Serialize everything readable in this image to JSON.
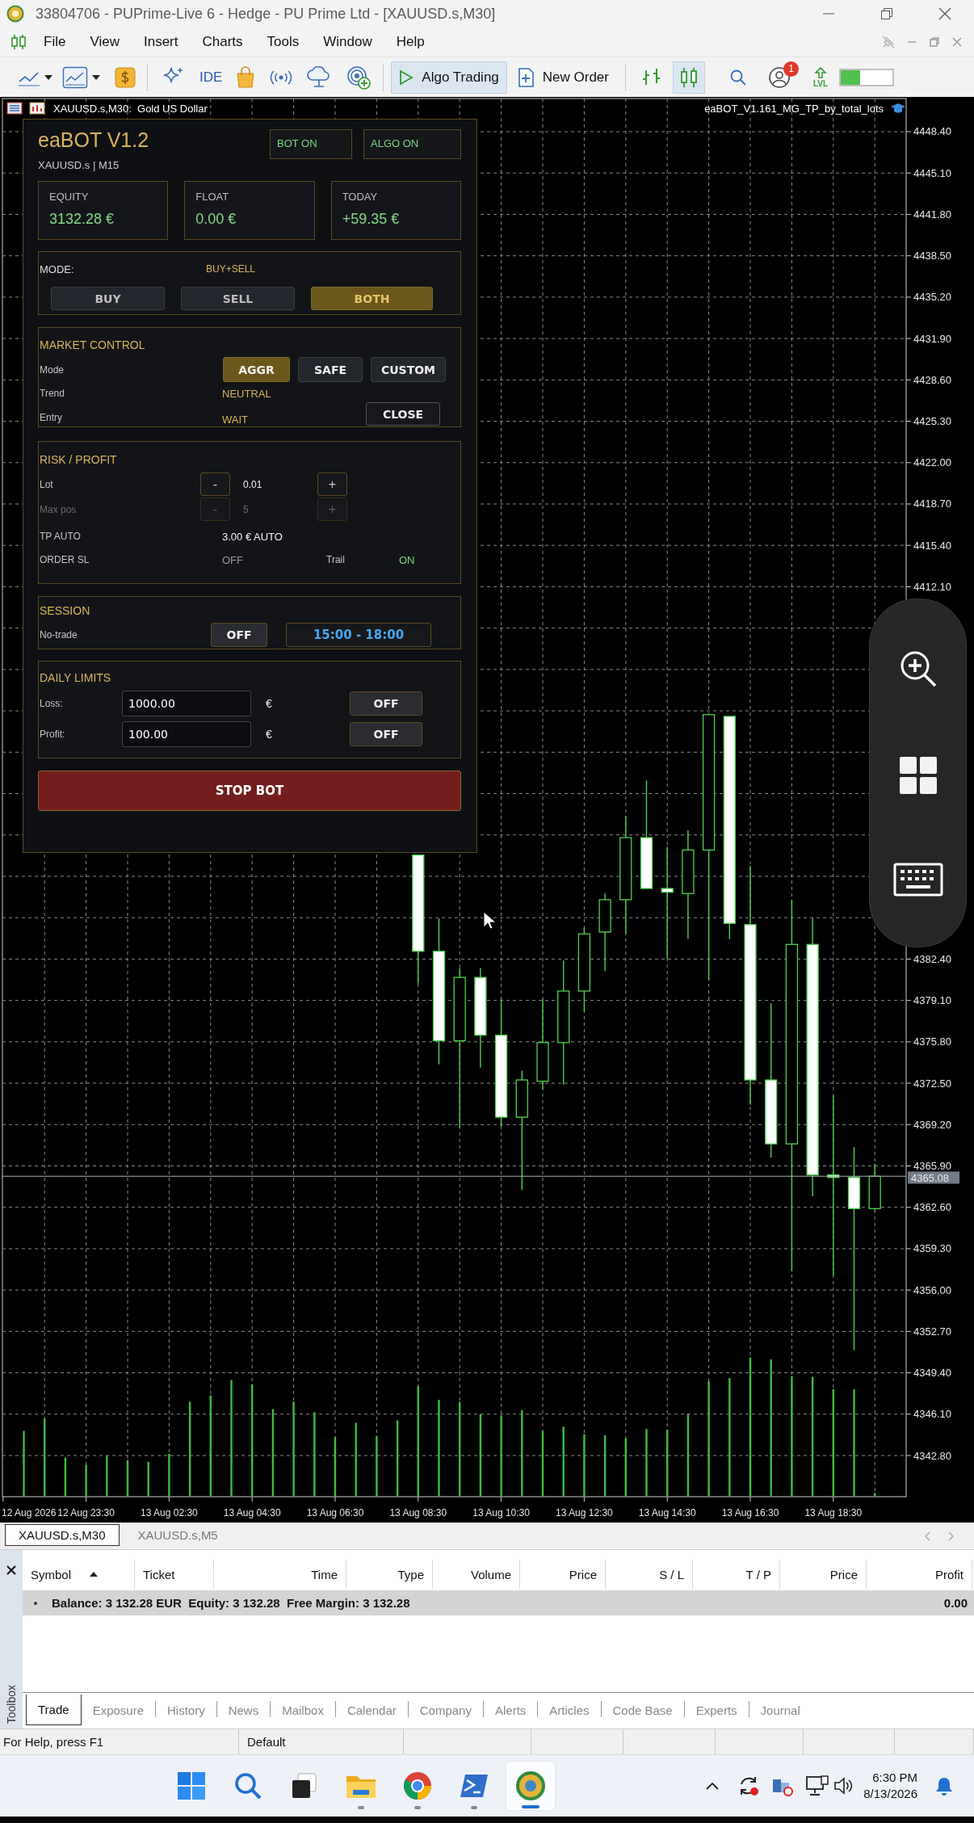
{
  "window": {
    "title": "33804706 - PUPrime-Live 6 - Hedge - PU Prime Ltd - [XAUUSD.s,M30]"
  },
  "menu": [
    "File",
    "View",
    "Insert",
    "Charts",
    "Tools",
    "Window",
    "Help"
  ],
  "toolbar": {
    "ide": "IDE",
    "algo_trading": {
      "label": "Algo Trading",
      "on": true
    },
    "new_order": "New Order",
    "chart_types": [
      {
        "kind": "bars",
        "selected": false
      },
      {
        "kind": "candles",
        "selected": true
      }
    ],
    "notification_badge": "1",
    "level_label": "LVL"
  },
  "chart": {
    "symbol": "XAUUSD.s,M30:  Gold US Dollar",
    "expert": "eaBOT_V1.161_MG_TP_by_total_lots",
    "current_price": "4365.08",
    "chart_data": {
      "type": "candlestick",
      "categories": [
        "12 Aug 2026",
        null,
        null,
        null,
        "12 Aug 23:30",
        null,
        null,
        null,
        "13 Aug 02:30",
        null,
        null,
        null,
        "13 Aug 04:30",
        null,
        null,
        null,
        "13 Aug 06:30",
        null,
        null,
        null,
        "13 Aug 08:30",
        null,
        null,
        null,
        "13 Aug 10:30",
        null,
        null,
        null,
        "13 Aug 12:30",
        null,
        null,
        null,
        "13 Aug 14:30",
        null,
        null,
        null,
        "13 Aug 16:30",
        null,
        null,
        null,
        "13 Aug 18:30",
        null,
        null
      ],
      "ohlc": [
        null,
        null,
        null,
        null,
        null,
        null,
        null,
        null,
        null,
        null,
        null,
        null,
        null,
        null,
        null,
        null,
        null,
        null,
        null,
        null,
        [
          4390.7,
          4390.7,
          4380.44,
          4383.02
        ],
        [
          4383.02,
          4385.65,
          4374.0,
          4375.89
        ],
        [
          4375.89,
          4381.68,
          4368.95,
          4380.94
        ],
        [
          4380.94,
          4381.68,
          4373.75,
          4376.33
        ],
        [
          4376.33,
          4379.21,
          4369.05,
          4369.79
        ],
        [
          4369.79,
          4373.51,
          4363.99,
          4372.76
        ],
        [
          4372.66,
          4379.21,
          4372.02,
          4375.74
        ],
        [
          4375.74,
          4382.28,
          4372.37,
          4379.85
        ],
        [
          4379.85,
          4384.9,
          4378.21,
          4384.41
        ],
        [
          4384.56,
          4387.63,
          4381.44,
          4387.14
        ],
        [
          4387.14,
          4393.83,
          4384.41,
          4392.09
        ],
        [
          4392.09,
          4396.65,
          4388.03,
          4388.03
        ],
        [
          4388.03,
          4391.35,
          4382.43,
          4387.73
        ],
        [
          4387.63,
          4392.69,
          4384.01,
          4391.1
        ],
        [
          4391.1,
          4401.9,
          4380.69,
          4401.9
        ],
        [
          4401.76,
          4401.76,
          4384.01,
          4385.25
        ],
        [
          4385.15,
          4389.86,
          4370.78,
          4372.76
        ],
        [
          4372.76,
          4378.86,
          4366.57,
          4367.66
        ],
        [
          4367.66,
          4387.14,
          4357.5,
          4383.57
        ],
        [
          4383.57,
          4385.65,
          4363.49,
          4365.18
        ],
        [
          4365.18,
          4371.52,
          4357.15,
          4364.98
        ],
        [
          4364.98,
          4367.41,
          4351.2,
          4362.5
        ],
        [
          4362.5,
          4366.07,
          4362.36,
          4365.08
        ]
      ],
      "ylim": [
        4339.52,
        4451.04
      ],
      "grid": true,
      "ref_lines": [
        {
          "axis": "y",
          "value": 4365.08
        }
      ],
      "yticks": [
        {
          "value": 4448.4,
          "label": "4448.40"
        },
        {
          "value": 4445.1,
          "label": "4445.10"
        },
        {
          "value": 4441.8,
          "label": "4441.80"
        },
        {
          "value": 4438.5,
          "label": "4438.50"
        },
        {
          "value": 4435.2,
          "label": "4435.20"
        },
        {
          "value": 4431.9,
          "label": "4431.90"
        },
        {
          "value": 4428.6,
          "label": "4428.60"
        },
        {
          "value": 4425.3,
          "label": "4425.30"
        },
        {
          "value": 4422.0,
          "label": "4422.00"
        },
        {
          "value": 4418.7,
          "label": "4418.70"
        },
        {
          "value": 4415.4,
          "label": "4415.40"
        },
        {
          "value": 4412.1,
          "label": "4412.10"
        },
        {
          "value": 4382.4,
          "label": "4382.40"
        },
        {
          "value": 4379.1,
          "label": "4379.10"
        },
        {
          "value": 4375.8,
          "label": "4375.80"
        },
        {
          "value": 4372.5,
          "label": "4372.50"
        },
        {
          "value": 4369.2,
          "label": "4369.20"
        },
        {
          "value": 4365.9,
          "label": "4365.90"
        },
        {
          "value": 4362.6,
          "label": "4362.60"
        },
        {
          "value": 4359.3,
          "label": "4359.30"
        },
        {
          "value": 4356.0,
          "label": "4356.00"
        },
        {
          "value": 4352.7,
          "label": "4352.70"
        },
        {
          "value": 4349.4,
          "label": "4349.40"
        },
        {
          "value": 4346.1,
          "label": "4346.10"
        },
        {
          "value": 4342.8,
          "label": "4342.80"
        }
      ]
    }
  },
  "panel": {
    "title": "eaBOT V1.2",
    "subtitle": "XAUUSD.s | M15",
    "status": [
      {
        "label": "BOT ON",
        "on": true
      },
      {
        "label": "ALGO ON",
        "on": true
      }
    ],
    "stats": [
      {
        "label": "EQUITY",
        "value": "3132.28 €"
      },
      {
        "label": "FLOAT",
        "value": "0.00 €"
      },
      {
        "label": "TODAY",
        "value": "+59.35 €"
      }
    ],
    "mode": {
      "label": "MODE:",
      "value": "BUY+SELL",
      "options": [
        {
          "label": "BUY",
          "selected": false
        },
        {
          "label": "SELL",
          "selected": false
        },
        {
          "label": "BOTH",
          "selected": true
        }
      ]
    },
    "market_control": {
      "title": "MARKET CONTROL",
      "mode_label": "Mode",
      "modes": [
        {
          "label": "AGGR",
          "selected": true
        },
        {
          "label": "SAFE",
          "selected": false
        },
        {
          "label": "CUSTOM",
          "selected": false
        }
      ],
      "trend_label": "Trend",
      "trend": "NEUTRAL",
      "entry_label": "Entry",
      "entry": "WAIT",
      "close_button": "CLOSE"
    },
    "risk_profit": {
      "title": "RISK / PROFIT",
      "steppers": [
        {
          "label": "Lot",
          "minus": "-",
          "value": "0.01",
          "plus": "+",
          "disabled": false
        },
        {
          "label": "Max pos",
          "minus": "-",
          "value": "5",
          "plus": "+",
          "disabled": true
        }
      ],
      "tp_label": "TP AUTO",
      "tp_value": "3.00 € AUTO",
      "sl_label": "ORDER SL",
      "sl": {
        "label": "OFF",
        "on": false
      },
      "trail_label": "Trail",
      "trail": {
        "label": "ON",
        "on": true
      }
    },
    "session": {
      "title": "SESSION",
      "label": "No-trade",
      "toggle": {
        "label": "OFF",
        "on": false
      },
      "hours": "15:00 - 18:00"
    },
    "daily_limits": {
      "title": "DAILY LIMITS",
      "rows": [
        {
          "label": "Loss:",
          "value": "1000.00",
          "currency": "€",
          "toggle": {
            "label": "OFF",
            "on": false
          }
        },
        {
          "label": "Profit:",
          "value": "100.00",
          "currency": "€",
          "toggle": {
            "label": "OFF",
            "on": false
          }
        }
      ]
    },
    "stop_button": "STOP BOT"
  },
  "chart_tabs": [
    {
      "label": "XAUUSD.s,M30",
      "selected": true
    },
    {
      "label": "XAUUSD.s,M5",
      "selected": false
    }
  ],
  "toolbox": {
    "side_label": "Toolbox",
    "columns": [
      {
        "label": "Symbol",
        "sorted": true
      },
      {
        "label": "Ticket",
        "sorted": false
      },
      {
        "label": "Time",
        "sorted": false
      },
      {
        "label": "Type",
        "sorted": false
      },
      {
        "label": "Volume",
        "sorted": false
      },
      {
        "label": "Price",
        "sorted": false
      },
      {
        "label": "S / L",
        "sorted": false
      },
      {
        "label": "T / P",
        "sorted": false
      },
      {
        "label": "Price",
        "sorted": false
      },
      {
        "label": "Profit",
        "sorted": false
      }
    ],
    "summary": {
      "text": "Balance: 3 132.28 EUR  Equity: 3 132.28  Free Margin: 3 132.28",
      "profit": "0.00"
    },
    "tabs": [
      {
        "label": "Trade",
        "selected": true
      },
      {
        "label": "Exposure",
        "selected": false
      },
      {
        "label": "History",
        "selected": false
      },
      {
        "label": "News",
        "selected": false
      },
      {
        "label": "Mailbox",
        "selected": false
      },
      {
        "label": "Calendar",
        "selected": false
      },
      {
        "label": "Company",
        "selected": false
      },
      {
        "label": "Alerts",
        "selected": false
      },
      {
        "label": "Articles",
        "selected": false
      },
      {
        "label": "Code Base",
        "selected": false
      },
      {
        "label": "Experts",
        "selected": false
      },
      {
        "label": "Journal",
        "selected": false
      }
    ]
  },
  "status_bar": [
    "For Help, press F1",
    "Default"
  ],
  "taskbar": {
    "apps": [
      {
        "kind": "start",
        "running": false,
        "selected": false
      },
      {
        "kind": "search",
        "running": false,
        "selected": false
      },
      {
        "kind": "task_view",
        "running": false,
        "selected": false
      },
      {
        "kind": "file_explorer",
        "running": true,
        "selected": false
      },
      {
        "kind": "browser",
        "running": true,
        "selected": false
      },
      {
        "kind": "terminal",
        "running": true,
        "selected": false
      },
      {
        "kind": "metatrader",
        "running": true,
        "selected": true
      }
    ],
    "time": "6:30 PM",
    "date": "8/13/2026"
  }
}
